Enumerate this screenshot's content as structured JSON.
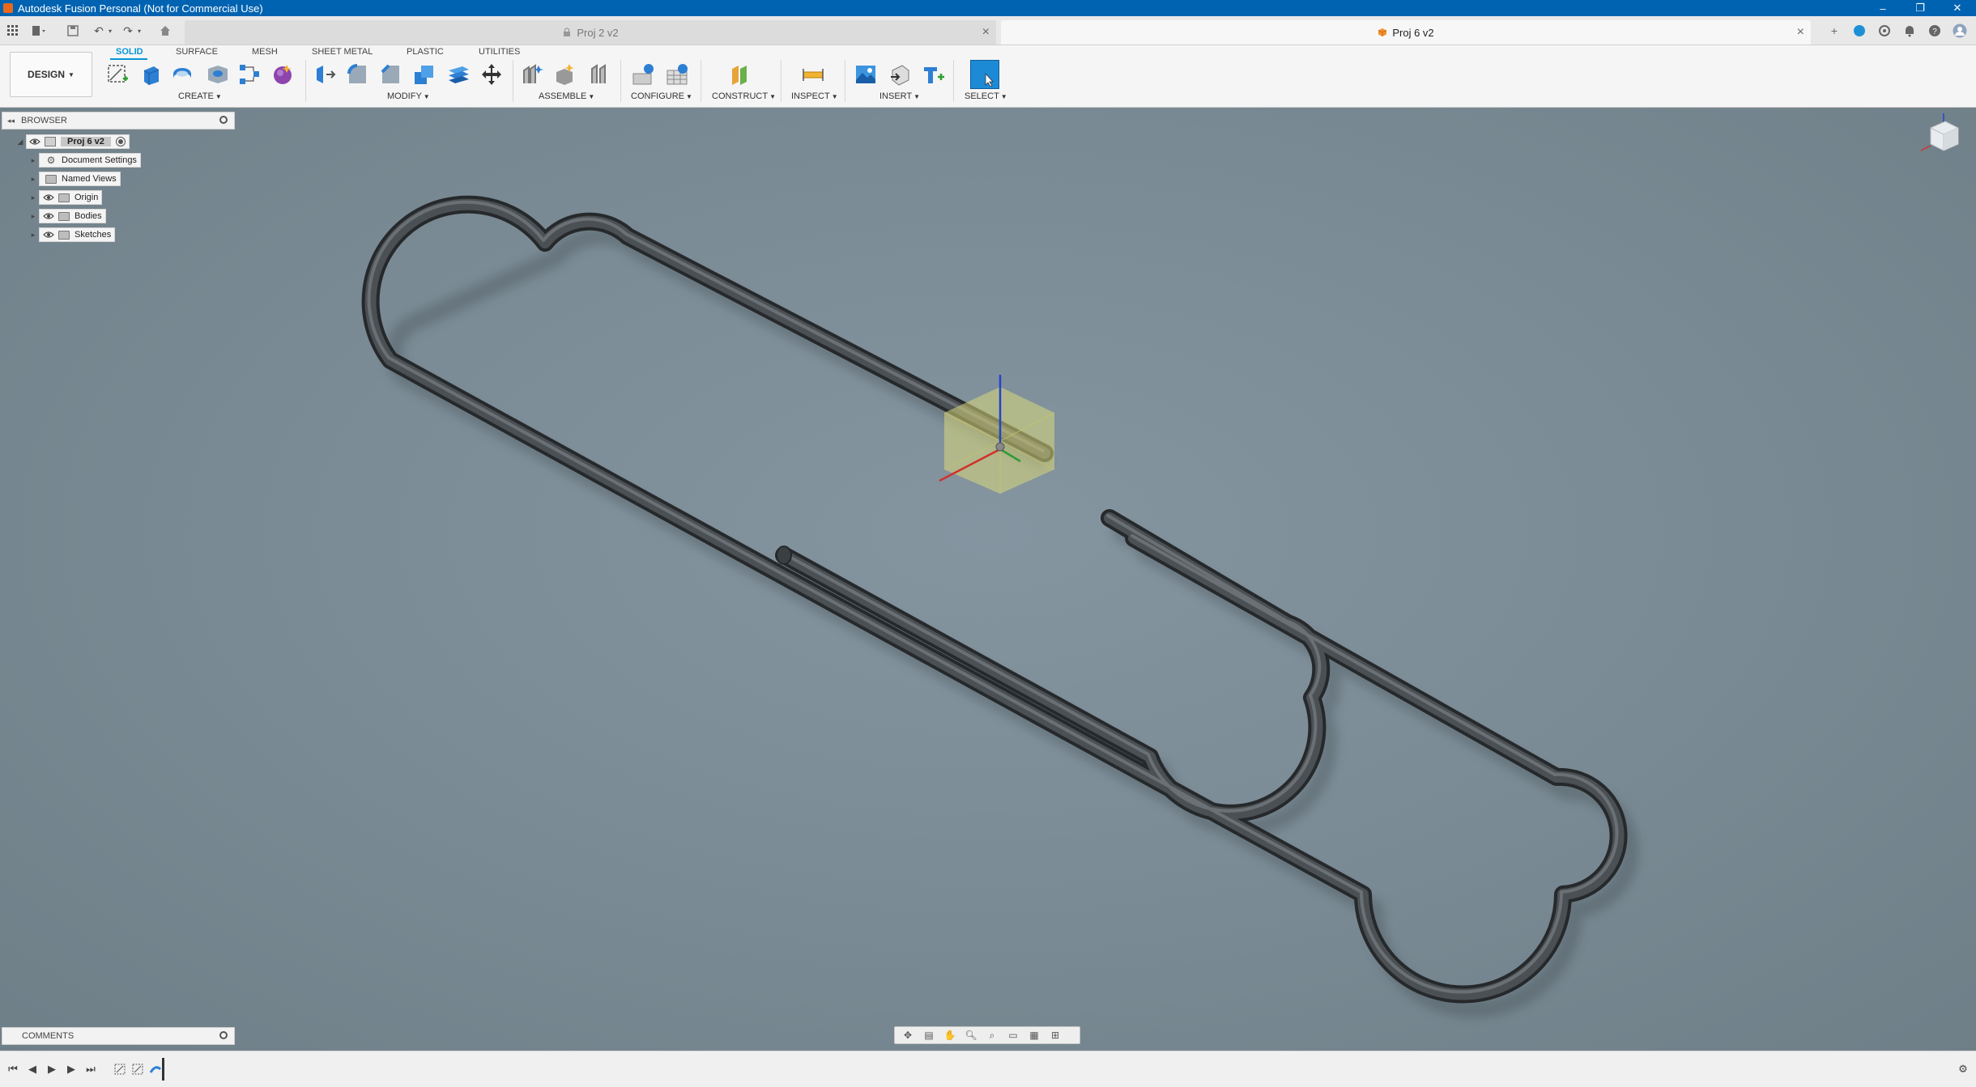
{
  "window": {
    "title": "Autodesk Fusion Personal (Not for Commercial Use)",
    "controls": [
      "–",
      "❐",
      "✕"
    ]
  },
  "tabs": {
    "inactive": {
      "label": "Proj 2 v2"
    },
    "active": {
      "label": "Proj 6 v2"
    }
  },
  "toolbar": {
    "design_label": "DESIGN",
    "workspace_tabs": [
      "SOLID",
      "SURFACE",
      "MESH",
      "SHEET METAL",
      "PLASTIC",
      "UTILITIES"
    ],
    "active_workspace": "SOLID",
    "groups": {
      "create": "CREATE",
      "modify": "MODIFY",
      "assemble": "ASSEMBLE",
      "configure": "CONFIGURE",
      "construct": "CONSTRUCT",
      "inspect": "INSPECT",
      "insert": "INSERT",
      "select": "SELECT"
    }
  },
  "browser": {
    "title": "BROWSER",
    "root": "Proj 6 v2",
    "items": [
      {
        "label": "Document Settings",
        "icon": "gear-icon"
      },
      {
        "label": "Named Views",
        "icon": "folder-icon"
      },
      {
        "label": "Origin",
        "icon": "folder-icon"
      },
      {
        "label": "Bodies",
        "icon": "folder-icon"
      },
      {
        "label": "Sketches",
        "icon": "folder-icon"
      }
    ]
  },
  "comments": {
    "title": "COMMENTS"
  },
  "colors": {
    "titlebar": "#0063b1",
    "accent": "#0696d7",
    "viewport_bg": "#7c8c95",
    "model": "#3a3f42"
  }
}
